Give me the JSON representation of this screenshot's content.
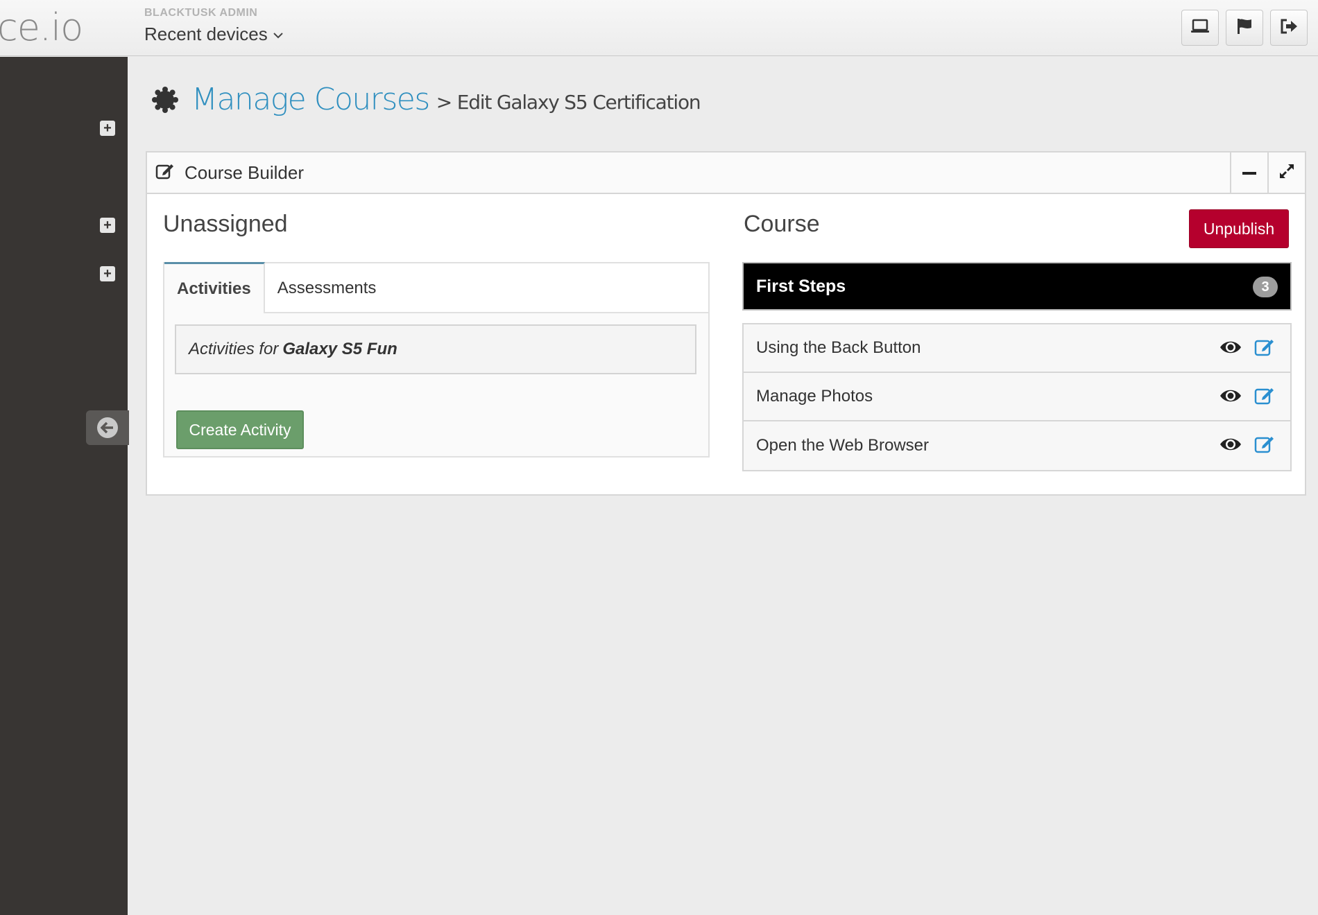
{
  "header": {
    "logo_text": "ce.io",
    "org_label": "BLACKTUSK ADMIN",
    "device_selector": "Recent devices",
    "actions": [
      "laptop-icon",
      "flag-icon",
      "sign-out-icon"
    ]
  },
  "sidebar": {
    "items": [
      "plus-square-icon",
      "plus-square-icon",
      "plus-square-icon"
    ],
    "collapse": "arrow-circle-left-icon"
  },
  "page": {
    "title": "Manage Courses",
    "subtitle": "> Edit Galaxy S5 Certification",
    "title_color": "#2f8fbf"
  },
  "panel": {
    "title": "Course Builder",
    "controls": [
      "minus-icon",
      "expand-icon"
    ]
  },
  "unassigned": {
    "heading": "Unassigned",
    "tabs": [
      {
        "label": "Activities",
        "active": true
      },
      {
        "label": "Assessments",
        "active": false
      }
    ],
    "info_prefix": "Activities for",
    "info_name": "Galaxy S5 Fun",
    "create_button": "Create Activity",
    "create_color": "#6b9e6b"
  },
  "course": {
    "heading": "Course",
    "unpublish_button": "Unpublish",
    "unpublish_color": "#b5002d",
    "section": {
      "name": "First Steps",
      "count": "3"
    },
    "activities": [
      {
        "name": "Using the Back Button"
      },
      {
        "name": "Manage Photos"
      },
      {
        "name": "Open the Web Browser"
      }
    ]
  }
}
